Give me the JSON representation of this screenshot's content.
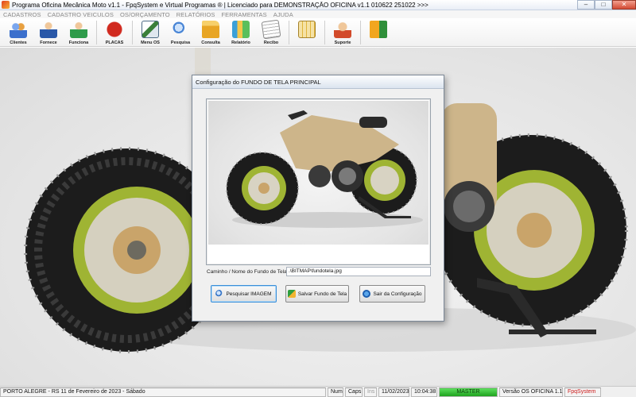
{
  "window": {
    "title": "Programa Oficina Mecânica Moto v1.1 - FpqSystem e Virtual Programas ® | Licenciado para  DEMONSTRAÇÃO OFICINA v1.1 010622 251022 >>>",
    "minimize": "–",
    "maximize": "□",
    "close": "✕"
  },
  "menu": [
    "CADASTROS",
    "CADASTRO VEICULOS",
    "OS/ORÇAMENTO",
    "RELATÓRIOS",
    "FERRAMENTAS",
    "AJUDA"
  ],
  "toolbar": [
    {
      "label": "Clientes",
      "icon": "clients-icon",
      "color": "#3b6fcc"
    },
    {
      "label": "Fornece",
      "icon": "supplier-icon",
      "color": "#2a58a8"
    },
    {
      "label": "Funciona",
      "icon": "employee-icon",
      "color": "#2e9b4a"
    },
    {
      "label": "PLACAS",
      "icon": "plates-icon",
      "color": "#d12a1f"
    },
    {
      "label": "Menu OS",
      "icon": "os-menu-icon",
      "color": "#3a7f3a"
    },
    {
      "label": "Pesquisa",
      "icon": "search-icon",
      "color": "#4a86d6"
    },
    {
      "label": "Consulta",
      "icon": "folder-icon",
      "color": "#e8a524"
    },
    {
      "label": "Relatório",
      "icon": "report-icon",
      "color": "#3aa0d8"
    },
    {
      "label": "Recibo",
      "icon": "receipt-icon",
      "color": "#8a8a8a"
    },
    {
      "label": "",
      "icon": "calculator-icon",
      "color": "#e0b43a"
    },
    {
      "label": "Suporte",
      "icon": "support-icon",
      "color": "#d24a2a"
    },
    {
      "label": "",
      "icon": "exit-icon",
      "color": "#2f8f3a"
    }
  ],
  "dialog": {
    "title": "Configuração do FUNDO DE TELA PRINCIPAL",
    "path_label": "Caminho / Nome do Fundo de Tela",
    "path_value": ".\\BITMAP\\fundotela.jpg",
    "buttons": {
      "search": "Pesquisar IMAGEM",
      "save": "Salvar Fundo de Tela",
      "exit": "Sair da Configuração"
    }
  },
  "statusbar": {
    "location": "PORTO ALEGRE - RS 11 de Fevereiro de 2023 - Sábado",
    "num": "Num",
    "caps": "Caps",
    "ins": "Ins",
    "date": "11/02/2023",
    "time": "10:04:38",
    "master": "MASTER",
    "version": "Versão OS OFICINA 1.1",
    "brand": "FpqSystem"
  }
}
